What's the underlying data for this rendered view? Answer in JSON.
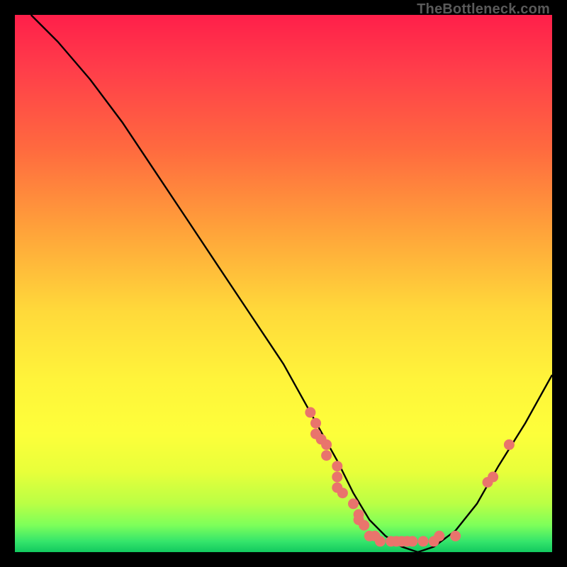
{
  "watermark": "TheBottleneck.com",
  "chart_data": {
    "type": "line",
    "title": "",
    "xlabel": "",
    "ylabel": "",
    "xlim": [
      0,
      100
    ],
    "ylim": [
      0,
      100
    ],
    "grid": false,
    "legend": false,
    "background": "rainbow-gradient",
    "curve": {
      "name": "bottleneck-curve",
      "x": [
        3,
        8,
        14,
        20,
        26,
        32,
        38,
        44,
        50,
        55,
        60,
        63,
        66,
        69,
        72,
        75,
        78,
        82,
        86,
        90,
        95,
        100
      ],
      "y": [
        100,
        95,
        88,
        80,
        71,
        62,
        53,
        44,
        35,
        26,
        17,
        11,
        6,
        3,
        1,
        0,
        1,
        4,
        9,
        16,
        24,
        33
      ]
    },
    "markers": {
      "name": "highlighted-points",
      "color": "#e9746c",
      "points": [
        {
          "x": 55,
          "y": 26
        },
        {
          "x": 56,
          "y": 24
        },
        {
          "x": 56,
          "y": 22
        },
        {
          "x": 57,
          "y": 21
        },
        {
          "x": 58,
          "y": 20
        },
        {
          "x": 58,
          "y": 18
        },
        {
          "x": 60,
          "y": 16
        },
        {
          "x": 60,
          "y": 14
        },
        {
          "x": 60,
          "y": 12
        },
        {
          "x": 61,
          "y": 11
        },
        {
          "x": 63,
          "y": 9
        },
        {
          "x": 64,
          "y": 7
        },
        {
          "x": 64,
          "y": 6
        },
        {
          "x": 65,
          "y": 5
        },
        {
          "x": 66,
          "y": 3
        },
        {
          "x": 67,
          "y": 3
        },
        {
          "x": 68,
          "y": 2
        },
        {
          "x": 70,
          "y": 2
        },
        {
          "x": 71,
          "y": 2
        },
        {
          "x": 72,
          "y": 2
        },
        {
          "x": 73,
          "y": 2
        },
        {
          "x": 74,
          "y": 2
        },
        {
          "x": 76,
          "y": 2
        },
        {
          "x": 78,
          "y": 2
        },
        {
          "x": 79,
          "y": 3
        },
        {
          "x": 82,
          "y": 3
        },
        {
          "x": 88,
          "y": 13
        },
        {
          "x": 89,
          "y": 14
        },
        {
          "x": 92,
          "y": 20
        }
      ]
    }
  }
}
